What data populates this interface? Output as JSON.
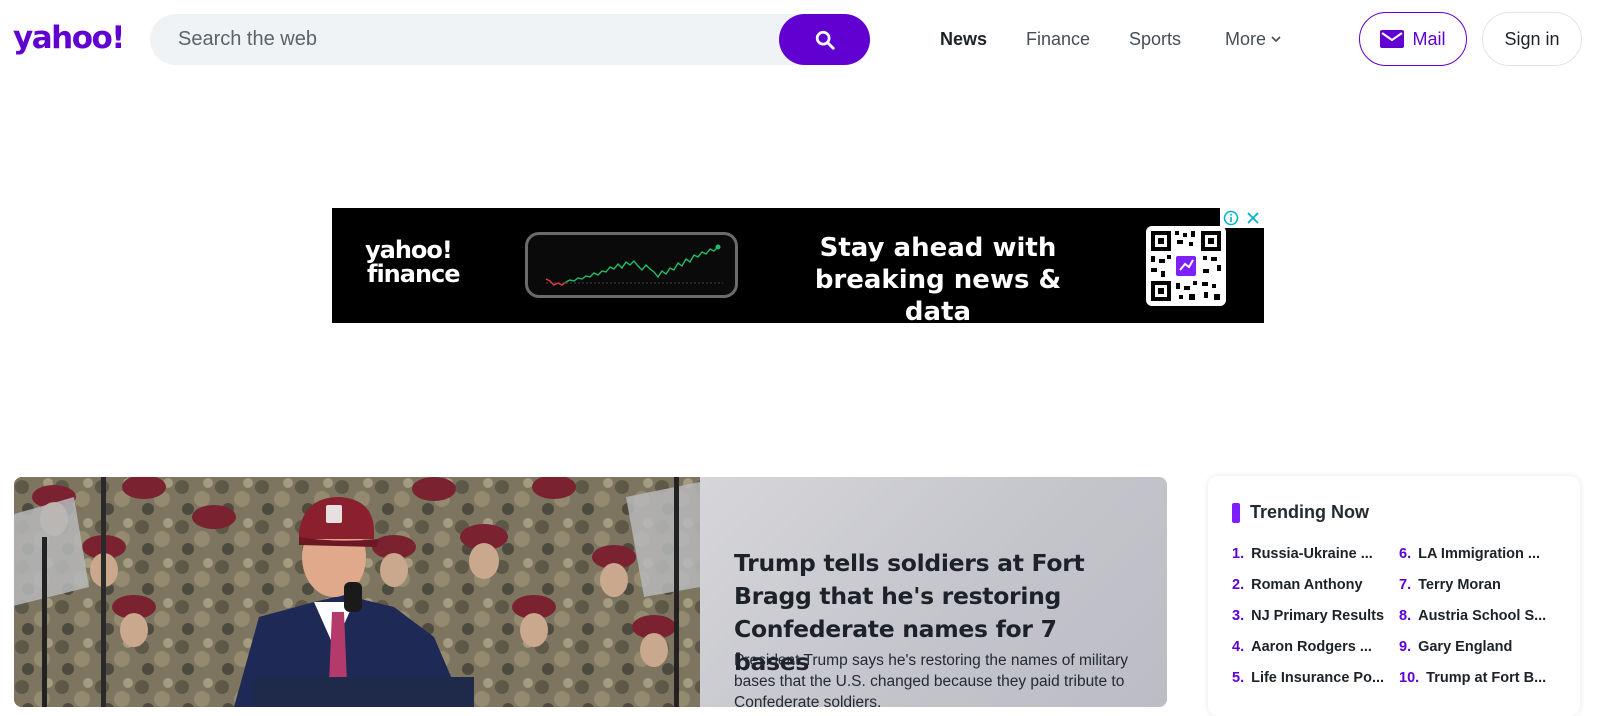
{
  "brand": {
    "logo_text": "yahoo!"
  },
  "search": {
    "placeholder": "Search the web"
  },
  "nav": [
    {
      "label": "News"
    },
    {
      "label": "Finance"
    },
    {
      "label": "Sports"
    },
    {
      "label": "More"
    }
  ],
  "account": {
    "mail_label": "Mail",
    "signin_label": "Sign in"
  },
  "ad": {
    "logo_line1": "yahoo!",
    "logo_line2": "finance",
    "headline_line1": "Stay ahead with",
    "headline_line2": "breaking news & data"
  },
  "hero": {
    "title": "Trump tells soldiers at Fort Bragg that he's restoring Confederate names for 7 bases",
    "summary": "President Trump says he's restoring the names of military bases that the U.S. changed because they paid tribute to Confederate soldiers."
  },
  "trending": {
    "title": "Trending Now",
    "items": [
      {
        "num": "1.",
        "label": "Russia-Ukraine ..."
      },
      {
        "num": "2.",
        "label": "Roman Anthony"
      },
      {
        "num": "3.",
        "label": "NJ Primary Results"
      },
      {
        "num": "4.",
        "label": "Aaron Rodgers ..."
      },
      {
        "num": "5.",
        "label": "Life Insurance Po..."
      },
      {
        "num": "6.",
        "label": "LA Immigration ..."
      },
      {
        "num": "7.",
        "label": "Terry Moran"
      },
      {
        "num": "8.",
        "label": "Austria School S..."
      },
      {
        "num": "9.",
        "label": "Gary England"
      },
      {
        "num": "10.",
        "label": "Trump at Fort B..."
      }
    ]
  },
  "colors": {
    "brand": "#6001d2",
    "accent": "#7e1fff"
  },
  "icons": [
    "search-icon",
    "mail-icon",
    "chevron-down-icon",
    "info-icon",
    "close-icon"
  ]
}
